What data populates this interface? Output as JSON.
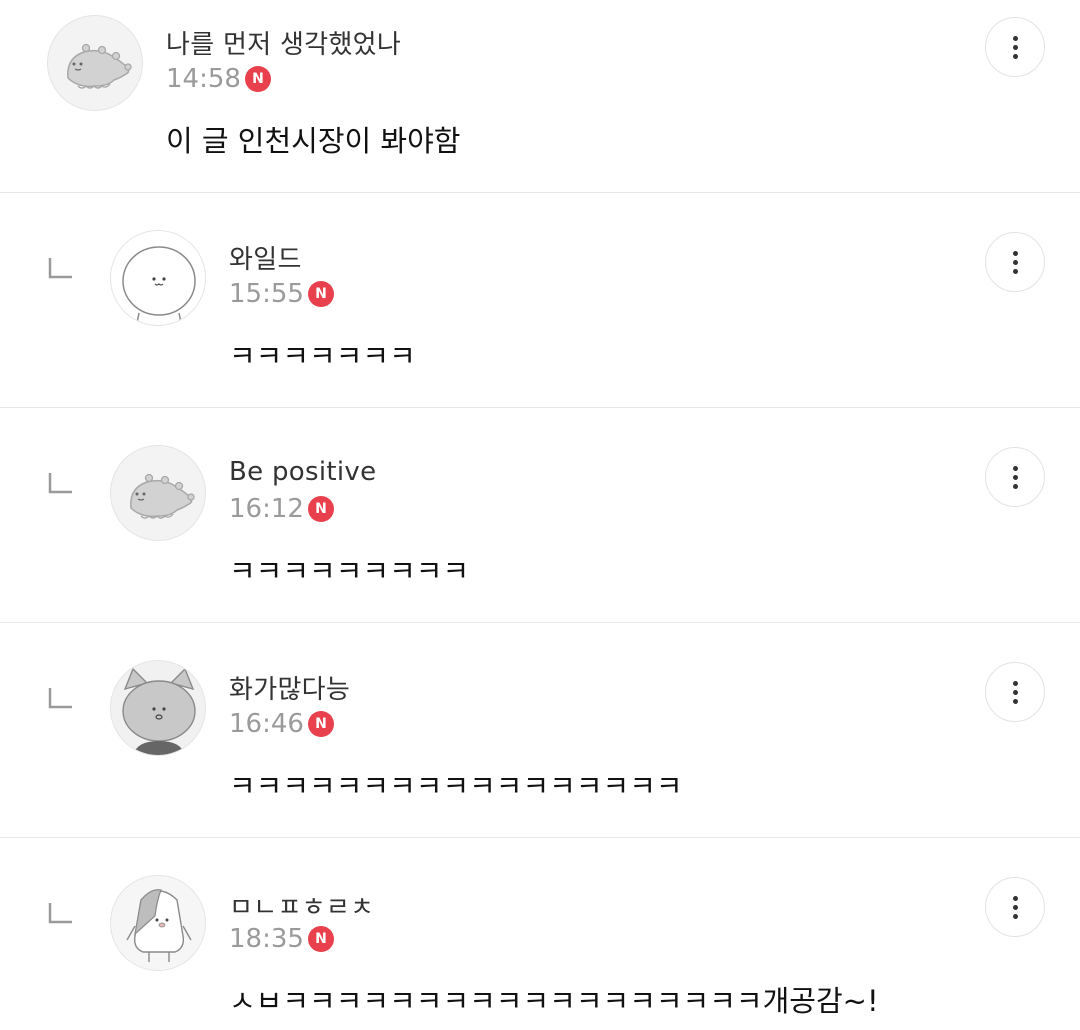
{
  "theme": {
    "badge_color": "#e8404c",
    "divider_color": "#e6e6e6"
  },
  "comments": [
    {
      "username": "나를 먼저 생각했었나",
      "time": "14:58",
      "badge": "N",
      "text": "이 글 인천시장이 봐야함",
      "avatar_icon": "dinosaur-avatar-icon",
      "is_reply": false
    },
    {
      "username": "와일드",
      "time": "15:55",
      "badge": "N",
      "text": "ㅋㅋㅋㅋㅋㅋㅋ",
      "avatar_icon": "white-bear-avatar-icon",
      "is_reply": true
    },
    {
      "username": "Be positive",
      "time": "16:12",
      "badge": "N",
      "text": "ㅋㅋㅋㅋㅋㅋㅋㅋㅋ",
      "avatar_icon": "dinosaur-avatar-icon",
      "is_reply": true
    },
    {
      "username": "화가많다능",
      "time": "16:46",
      "badge": "N",
      "text": "ㅋㅋㅋㅋㅋㅋㅋㅋㅋㅋㅋㅋㅋㅋㅋㅋㅋ",
      "avatar_icon": "gray-cat-avatar-icon",
      "is_reply": true
    },
    {
      "username": "ㅁㄴㅍㅎㄹㅊ",
      "time": "18:35",
      "badge": "N",
      "text": "ㅅㅂㅋㅋㅋㅋㅋㅋㅋㅋㅋㅋㅋㅋㅋㅋㅋㅋㅋㅋ개공감~!",
      "avatar_icon": "penguin-avatar-icon",
      "is_reply": true
    }
  ]
}
